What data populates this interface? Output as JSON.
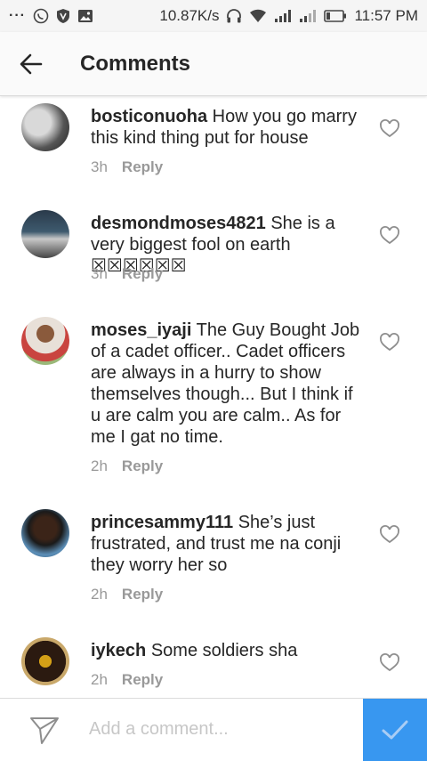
{
  "status_bar": {
    "speed": "10.87K/s",
    "time": "11:57 PM"
  },
  "header": {
    "title": "Comments"
  },
  "comments": [
    {
      "username": "bosticonuoha",
      "text": "How you go marry this kind thing put for house",
      "time": "3h",
      "reply": "Reply"
    },
    {
      "username": "desmondmoses4821",
      "text": "She is a very biggest fool on earth ☒☒☒☒☒☒",
      "time": "3h",
      "reply": "Reply"
    },
    {
      "username": "moses_iyaji",
      "text": "The Guy Bought Job of a cadet officer.. Cadet officers are always in a hurry to show themselves though... But I think if u are calm you are calm.. As for me I gat no time.",
      "time": "2h",
      "reply": "Reply"
    },
    {
      "username": "princesammy111",
      "text": "She’s just frustrated, and trust me na conji they worry her so",
      "time": "2h",
      "reply": "Reply"
    },
    {
      "username": "iykech",
      "text": "Some soldiers sha",
      "time": "2h",
      "reply": "Reply"
    }
  ],
  "composer": {
    "placeholder": "Add a comment..."
  },
  "colors": {
    "accent": "#3897f0",
    "muted": "#999999"
  }
}
